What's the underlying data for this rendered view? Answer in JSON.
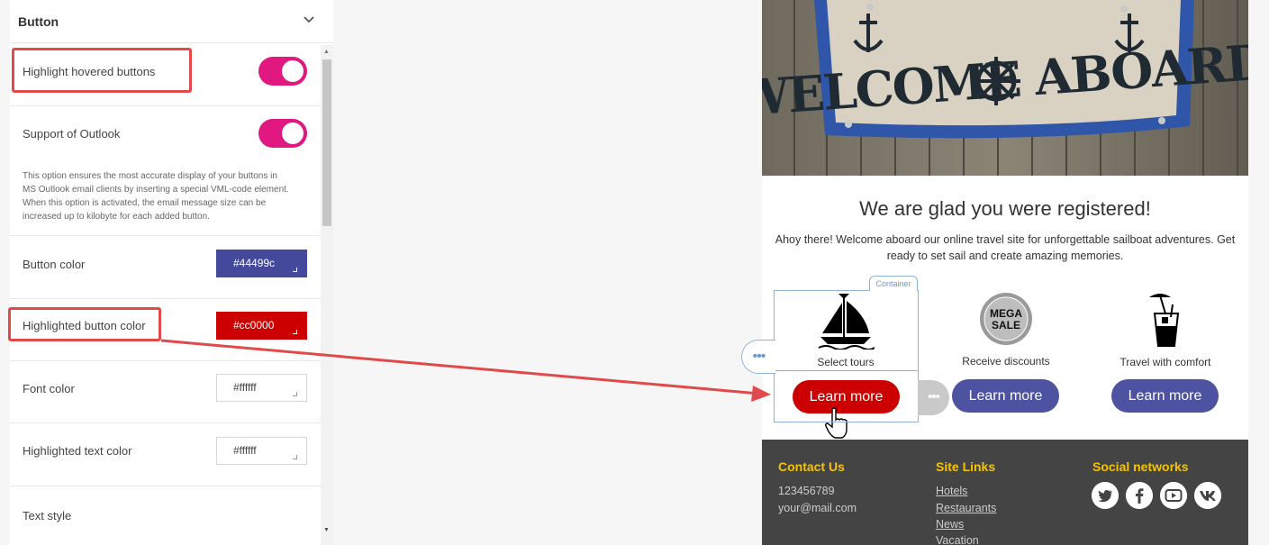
{
  "panel": {
    "title": "Button",
    "highlight_hovered": {
      "label": "Highlight hovered buttons",
      "on": true
    },
    "support_outlook": {
      "label": "Support of Outlook",
      "on": true,
      "desc_lines": [
        "This option ensures the most accurate display of your buttons in",
        "MS Outlook email clients by inserting a special VML-code element.",
        "When this option is activated, the email message size can be",
        "increased up to kilobyte for each added button."
      ]
    },
    "button_color": {
      "label": "Button color",
      "value": "#44499c"
    },
    "highlighted_button_color": {
      "label": "Highlighted button color",
      "value": "#cc0000"
    },
    "font_color": {
      "label": "Font color",
      "value": "#ffffff"
    },
    "highlighted_text_color": {
      "label": "Highlighted text color",
      "value": "#ffffff"
    },
    "text_style": {
      "label": "Text style"
    }
  },
  "email": {
    "heading": "We are glad you were registered!",
    "intro_lines": [
      "Ahoy there! Welcome aboard our online travel site for unforgettable sailboat adventures. Get",
      "ready to set sail and create amazing memories."
    ],
    "hero_sign": {
      "line1": "WELCOME",
      "line2": "ABOARD"
    },
    "container_tag": "Container",
    "columns": [
      {
        "caption": "Select tours",
        "button": "Learn more",
        "icon": "sailboat-icon",
        "button_color": "#cc0000"
      },
      {
        "caption": "Receive discounts",
        "button": "Learn more",
        "icon": "mega-sale-badge-icon",
        "badge_lines": [
          "MEGA",
          "SALE"
        ],
        "button_color": "#44499c"
      },
      {
        "caption": "Travel with comfort",
        "button": "Learn more",
        "icon": "cocktail-icon",
        "button_color": "#44499c"
      }
    ],
    "footer": {
      "contact": {
        "heading": "Contact Us",
        "phone": "123456789",
        "email": "your@mail.com"
      },
      "links": {
        "heading": "Site Links",
        "items": [
          "Hotels",
          "Restaurants",
          "News",
          "Vacation"
        ]
      },
      "social": {
        "heading": "Social networks",
        "icons": [
          "twitter-icon",
          "facebook-icon",
          "youtube-icon",
          "vk-icon"
        ]
      }
    }
  },
  "colors": {
    "accent_pink": "#e0187f",
    "footer_bg": "#444444",
    "footer_heading": "#f5c400",
    "annotation_red": "#e04a4a"
  }
}
